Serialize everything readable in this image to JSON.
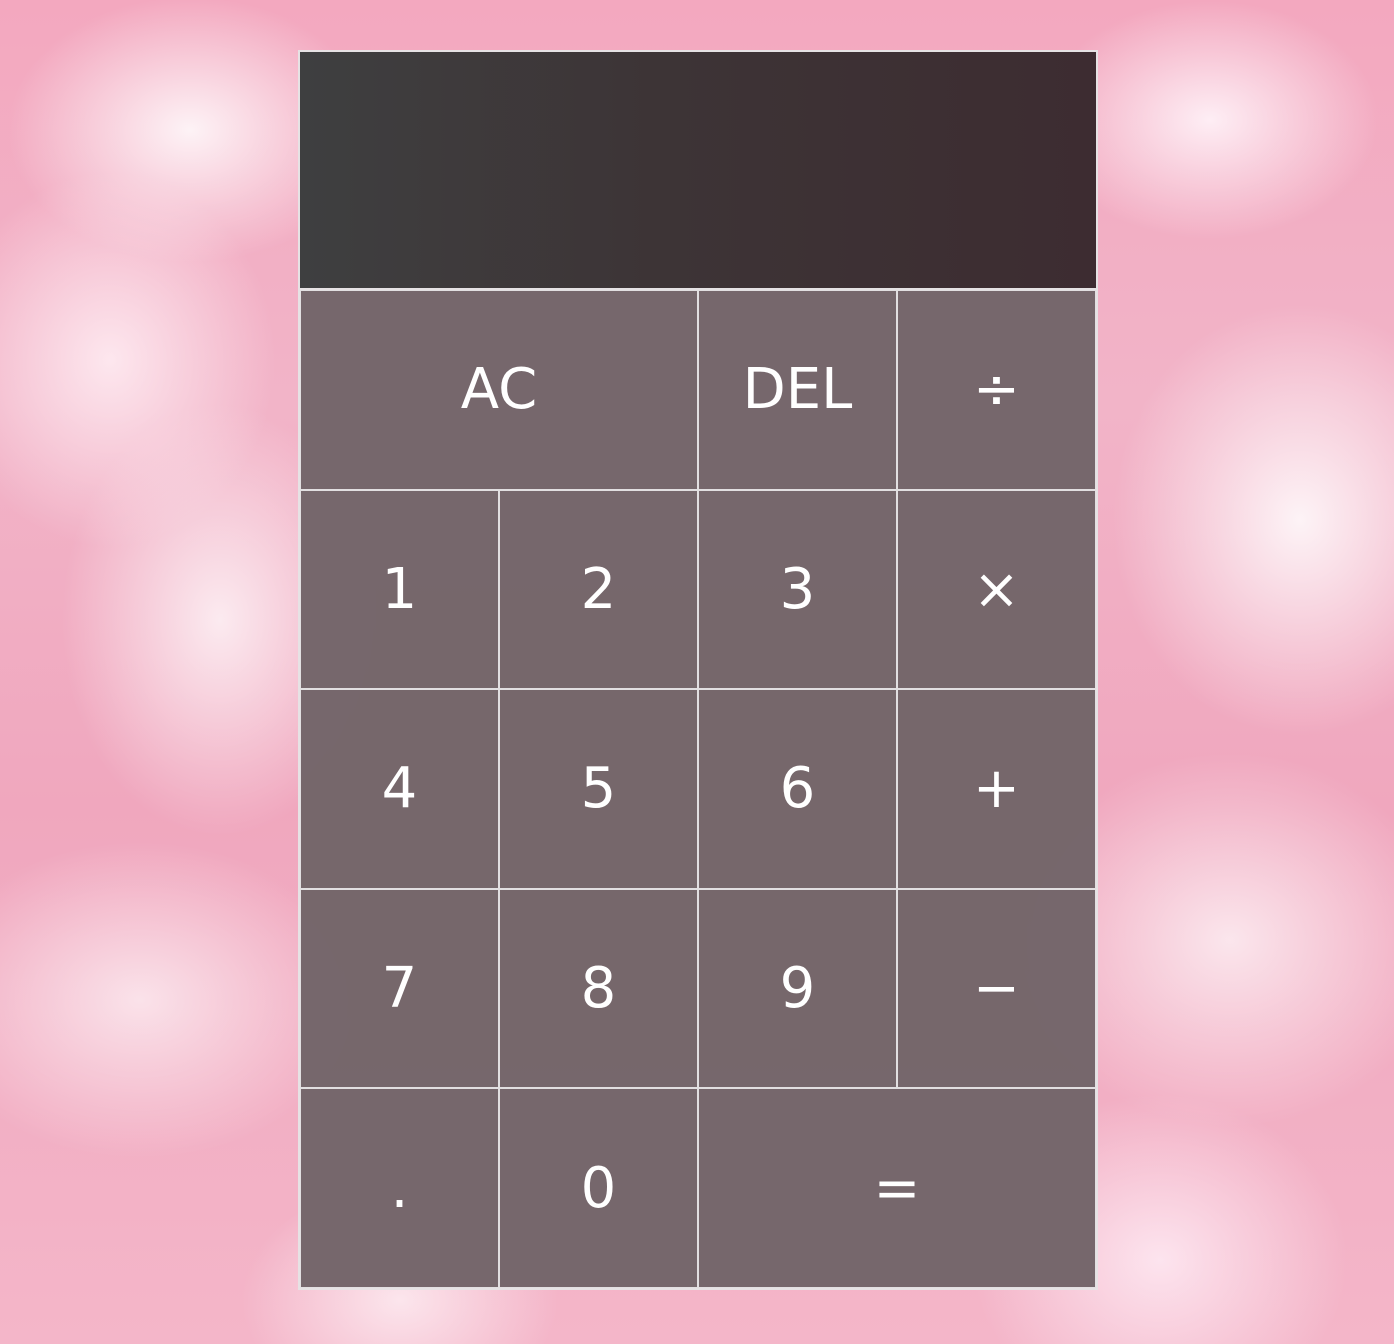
{
  "display": {
    "previous_operand": "",
    "current_operand": ""
  },
  "keys": {
    "all_clear": "AC",
    "delete": "DEL",
    "divide": "÷",
    "one": "1",
    "two": "2",
    "three": "3",
    "multiply": "×",
    "four": "4",
    "five": "5",
    "six": "6",
    "add": "+",
    "seven": "7",
    "eight": "8",
    "nine": "9",
    "subtract": "−",
    "decimal": ".",
    "zero": "0",
    "equals": "="
  },
  "colors": {
    "background": "#f3a8bf",
    "display": "#3d3436",
    "key": "#76676c",
    "border": "#e6e2e4",
    "text": "#ffffff"
  }
}
